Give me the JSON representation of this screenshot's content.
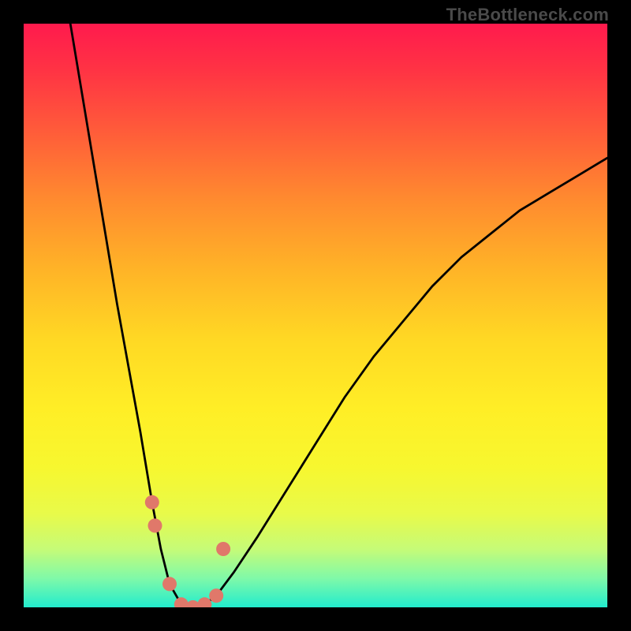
{
  "watermark": "TheBottleneck.com",
  "chart_data": {
    "type": "line",
    "title": "",
    "xlabel": "",
    "ylabel": "",
    "xlim": [
      0,
      100
    ],
    "ylim": [
      0,
      100
    ],
    "grid": false,
    "legend": false,
    "series": [
      {
        "name": "curve",
        "x": [
          8,
          10,
          12,
          14,
          16,
          18,
          20,
          22,
          23.5,
          25,
          27,
          29,
          31,
          33,
          36,
          40,
          45,
          50,
          55,
          60,
          65,
          70,
          75,
          80,
          85,
          90,
          95,
          100
        ],
        "values": [
          100,
          88,
          76,
          64,
          52,
          41,
          30,
          18,
          10,
          4,
          0.5,
          0,
          0.5,
          2,
          6,
          12,
          20,
          28,
          36,
          43,
          49,
          55,
          60,
          64,
          68,
          71,
          74,
          77
        ]
      }
    ],
    "markers": {
      "name": "highlight-points",
      "color": "#e0786a",
      "x": [
        22,
        22.5,
        25,
        27,
        29,
        31,
        33,
        34.2
      ],
      "values": [
        18,
        14,
        4,
        0.5,
        0,
        0.5,
        2,
        10
      ]
    },
    "background_gradient": {
      "direction": "vertical",
      "stops": [
        {
          "pos": 0.0,
          "color": "#ff1a4d"
        },
        {
          "pos": 0.3,
          "color": "#ff8a2f"
        },
        {
          "pos": 0.66,
          "color": "#ffee26"
        },
        {
          "pos": 1.0,
          "color": "#22eccd"
        }
      ]
    }
  }
}
